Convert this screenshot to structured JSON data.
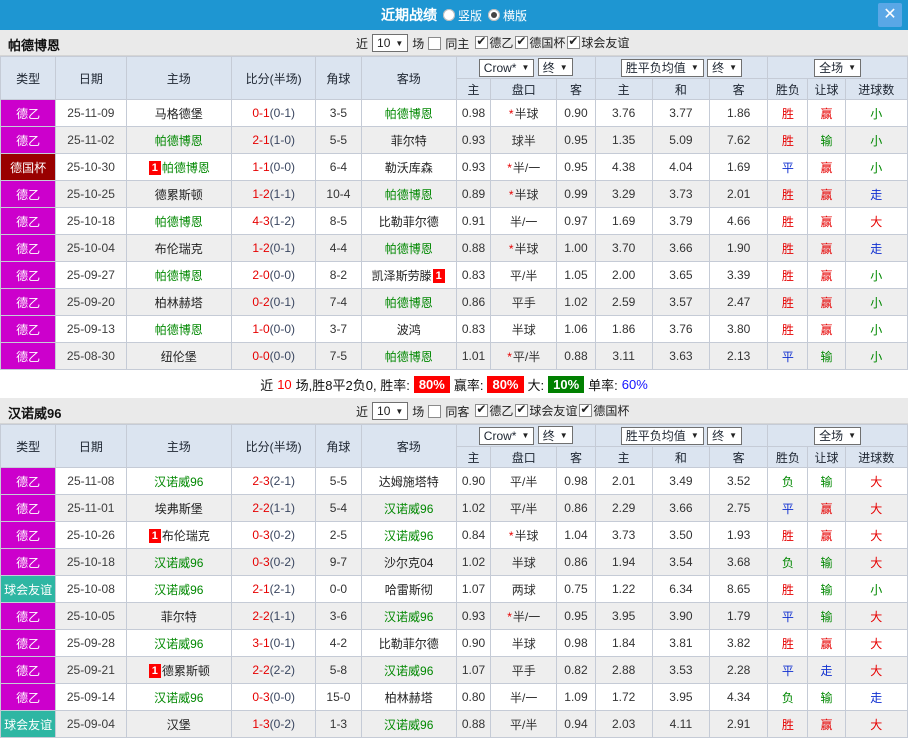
{
  "titlebar": {
    "title": "近期战绩",
    "radio_vertical": "竖版",
    "radio_horizontal": "横版",
    "close": "✕"
  },
  "table_header": {
    "col_type": "类型",
    "col_date": "日期",
    "col_home": "主场",
    "col_score": "比分(半场)",
    "col_corner": "角球",
    "col_away": "客场",
    "odds_dropdown": "Crow*",
    "final_dropdown": "终",
    "avg_dropdown": "胜平负均值",
    "fullmatch_dropdown": "全场",
    "sub_home": "主",
    "sub_handicap": "盘口",
    "sub_away": "客",
    "sub_home2": "主",
    "sub_draw": "和",
    "sub_away2": "客",
    "col_result": "胜负",
    "col_handicap_result": "让球",
    "col_goals": "进球数"
  },
  "sections": [
    {
      "team": "帕德博恩",
      "filter": {
        "near_label": "近",
        "count": "10",
        "matches_label": "场",
        "same_label": "同主",
        "same_checked": false,
        "leagues": [
          {
            "label": "德乙",
            "checked": true
          },
          {
            "label": "德国杯",
            "checked": true
          },
          {
            "label": "球会友谊",
            "checked": true
          }
        ]
      },
      "rows": [
        {
          "type": "德乙",
          "type_class": "t-league",
          "date": "25-11-09",
          "home": "马格德堡",
          "home_green": false,
          "home_badge": false,
          "ft": "0-1",
          "ht": "(0-1)",
          "corner": "3-5",
          "away": "帕德博恩",
          "away_green": true,
          "away_badge": false,
          "odds_home": "0.98",
          "handicap": "半球",
          "handicap_star": true,
          "odds_away": "0.90",
          "avg_home": "3.76",
          "avg_draw": "3.77",
          "avg_away": "1.86",
          "result": [
            "胜",
            "red"
          ],
          "handicap_result": [
            "赢",
            "red"
          ],
          "goals": [
            "小",
            "green"
          ]
        },
        {
          "type": "德乙",
          "type_class": "t-league",
          "date": "25-11-02",
          "home": "帕德博恩",
          "home_green": true,
          "home_badge": false,
          "ft": "2-1",
          "ht": "(1-0)",
          "corner": "5-5",
          "away": "菲尔特",
          "away_green": false,
          "away_badge": false,
          "odds_home": "0.93",
          "handicap": "球半",
          "handicap_star": false,
          "odds_away": "0.95",
          "avg_home": "1.35",
          "avg_draw": "5.09",
          "avg_away": "7.62",
          "result": [
            "胜",
            "red"
          ],
          "handicap_result": [
            "输",
            "green"
          ],
          "goals": [
            "小",
            "green"
          ]
        },
        {
          "type": "德国杯",
          "type_class": "t-cup",
          "date": "25-10-30",
          "home": "帕德博恩",
          "home_green": true,
          "home_badge": true,
          "ft": "1-1",
          "ht": "(0-0)",
          "corner": "6-4",
          "away": "勒沃库森",
          "away_green": false,
          "away_badge": false,
          "odds_home": "0.93",
          "handicap": "半/一",
          "handicap_star": true,
          "odds_away": "0.95",
          "avg_home": "4.38",
          "avg_draw": "4.04",
          "avg_away": "1.69",
          "result": [
            "平",
            "blue"
          ],
          "handicap_result": [
            "赢",
            "red"
          ],
          "goals": [
            "小",
            "green"
          ]
        },
        {
          "type": "德乙",
          "type_class": "t-league",
          "date": "25-10-25",
          "home": "德累斯顿",
          "home_green": false,
          "home_badge": false,
          "ft": "1-2",
          "ht": "(1-1)",
          "corner": "10-4",
          "away": "帕德博恩",
          "away_green": true,
          "away_badge": false,
          "odds_home": "0.89",
          "handicap": "半球",
          "handicap_star": true,
          "odds_away": "0.99",
          "avg_home": "3.29",
          "avg_draw": "3.73",
          "avg_away": "2.01",
          "result": [
            "胜",
            "red"
          ],
          "handicap_result": [
            "赢",
            "red"
          ],
          "goals": [
            "走",
            "blue"
          ]
        },
        {
          "type": "德乙",
          "type_class": "t-league",
          "date": "25-10-18",
          "home": "帕德博恩",
          "home_green": true,
          "home_badge": false,
          "ft": "4-3",
          "ht": "(1-2)",
          "corner": "8-5",
          "away": "比勒菲尔德",
          "away_green": false,
          "away_badge": false,
          "odds_home": "0.91",
          "handicap": "半/一",
          "handicap_star": false,
          "odds_away": "0.97",
          "avg_home": "1.69",
          "avg_draw": "3.79",
          "avg_away": "4.66",
          "result": [
            "胜",
            "red"
          ],
          "handicap_result": [
            "赢",
            "red"
          ],
          "goals": [
            "大",
            "red"
          ]
        },
        {
          "type": "德乙",
          "type_class": "t-league",
          "date": "25-10-04",
          "home": "布伦瑞克",
          "home_green": false,
          "home_badge": false,
          "ft": "1-2",
          "ht": "(0-1)",
          "corner": "4-4",
          "away": "帕德博恩",
          "away_green": true,
          "away_badge": false,
          "odds_home": "0.88",
          "handicap": "半球",
          "handicap_star": true,
          "odds_away": "1.00",
          "avg_home": "3.70",
          "avg_draw": "3.66",
          "avg_away": "1.90",
          "result": [
            "胜",
            "red"
          ],
          "handicap_result": [
            "赢",
            "red"
          ],
          "goals": [
            "走",
            "blue"
          ]
        },
        {
          "type": "德乙",
          "type_class": "t-league",
          "date": "25-09-27",
          "home": "帕德博恩",
          "home_green": true,
          "home_badge": false,
          "ft": "2-0",
          "ht": "(0-0)",
          "corner": "8-2",
          "away": "凯泽斯劳滕",
          "away_green": false,
          "away_badge": true,
          "odds_home": "0.83",
          "handicap": "平/半",
          "handicap_star": false,
          "odds_away": "1.05",
          "avg_home": "2.00",
          "avg_draw": "3.65",
          "avg_away": "3.39",
          "result": [
            "胜",
            "red"
          ],
          "handicap_result": [
            "赢",
            "red"
          ],
          "goals": [
            "小",
            "green"
          ]
        },
        {
          "type": "德乙",
          "type_class": "t-league",
          "date": "25-09-20",
          "home": "柏林赫塔",
          "home_green": false,
          "home_badge": false,
          "ft": "0-2",
          "ht": "(0-1)",
          "corner": "7-4",
          "away": "帕德博恩",
          "away_green": true,
          "away_badge": false,
          "odds_home": "0.86",
          "handicap": "平手",
          "handicap_star": false,
          "odds_away": "1.02",
          "avg_home": "2.59",
          "avg_draw": "3.57",
          "avg_away": "2.47",
          "result": [
            "胜",
            "red"
          ],
          "handicap_result": [
            "赢",
            "red"
          ],
          "goals": [
            "小",
            "green"
          ]
        },
        {
          "type": "德乙",
          "type_class": "t-league",
          "date": "25-09-13",
          "home": "帕德博恩",
          "home_green": true,
          "home_badge": false,
          "ft": "1-0",
          "ht": "(0-0)",
          "corner": "3-7",
          "away": "波鸿",
          "away_green": false,
          "away_badge": false,
          "odds_home": "0.83",
          "handicap": "半球",
          "handicap_star": false,
          "odds_away": "1.06",
          "avg_home": "1.86",
          "avg_draw": "3.76",
          "avg_away": "3.80",
          "result": [
            "胜",
            "red"
          ],
          "handicap_result": [
            "赢",
            "red"
          ],
          "goals": [
            "小",
            "green"
          ]
        },
        {
          "type": "德乙",
          "type_class": "t-league",
          "date": "25-08-30",
          "home": "纽伦堡",
          "home_green": false,
          "home_badge": false,
          "ft": "0-0",
          "ht": "(0-0)",
          "corner": "7-5",
          "away": "帕德博恩",
          "away_green": true,
          "away_badge": false,
          "odds_home": "1.01",
          "handicap": "平/半",
          "handicap_star": true,
          "odds_away": "0.88",
          "avg_home": "3.11",
          "avg_draw": "3.63",
          "avg_away": "2.13",
          "result": [
            "平",
            "blue"
          ],
          "handicap_result": [
            "输",
            "green"
          ],
          "goals": [
            "小",
            "green"
          ]
        }
      ],
      "summary": {
        "text_before": "近",
        "count": "10",
        "text_mid": "场,胜8平2负0, 胜率:",
        "rate1": "80%",
        "label_rate2": "赢率:",
        "rate2": "80%",
        "label_big": "大:",
        "big": "10%",
        "label_single": "单率:",
        "single": "60%"
      }
    },
    {
      "team": "汉诺威96",
      "filter": {
        "near_label": "近",
        "count": "10",
        "matches_label": "场",
        "same_label": "同客",
        "same_checked": false,
        "leagues": [
          {
            "label": "德乙",
            "checked": true
          },
          {
            "label": "球会友谊",
            "checked": true
          },
          {
            "label": "德国杯",
            "checked": true
          }
        ]
      },
      "rows": [
        {
          "type": "德乙",
          "type_class": "t-league",
          "date": "25-11-08",
          "home": "汉诺威96",
          "home_green": true,
          "home_badge": false,
          "ft": "2-3",
          "ht": "(2-1)",
          "corner": "5-5",
          "away": "达姆施塔特",
          "away_green": false,
          "away_badge": false,
          "odds_home": "0.90",
          "handicap": "平/半",
          "handicap_star": false,
          "odds_away": "0.98",
          "avg_home": "2.01",
          "avg_draw": "3.49",
          "avg_away": "3.52",
          "result": [
            "负",
            "green"
          ],
          "handicap_result": [
            "输",
            "green"
          ],
          "goals": [
            "大",
            "red"
          ]
        },
        {
          "type": "德乙",
          "type_class": "t-league",
          "date": "25-11-01",
          "home": "埃弗斯堡",
          "home_green": false,
          "home_badge": false,
          "ft": "2-2",
          "ht": "(1-1)",
          "corner": "5-4",
          "away": "汉诺威96",
          "away_green": true,
          "away_badge": false,
          "odds_home": "1.02",
          "handicap": "平/半",
          "handicap_star": false,
          "odds_away": "0.86",
          "avg_home": "2.29",
          "avg_draw": "3.66",
          "avg_away": "2.75",
          "result": [
            "平",
            "blue"
          ],
          "handicap_result": [
            "赢",
            "red"
          ],
          "goals": [
            "大",
            "red"
          ]
        },
        {
          "type": "德乙",
          "type_class": "t-league",
          "date": "25-10-26",
          "home": "布伦瑞克",
          "home_green": false,
          "home_badge": true,
          "ft": "0-3",
          "ht": "(0-2)",
          "corner": "2-5",
          "away": "汉诺威96",
          "away_green": true,
          "away_badge": false,
          "odds_home": "0.84",
          "handicap": "半球",
          "handicap_star": true,
          "odds_away": "1.04",
          "avg_home": "3.73",
          "avg_draw": "3.50",
          "avg_away": "1.93",
          "result": [
            "胜",
            "red"
          ],
          "handicap_result": [
            "赢",
            "red"
          ],
          "goals": [
            "大",
            "red"
          ]
        },
        {
          "type": "德乙",
          "type_class": "t-league",
          "date": "25-10-18",
          "home": "汉诺威96",
          "home_green": true,
          "home_badge": false,
          "ft": "0-3",
          "ht": "(0-2)",
          "corner": "9-7",
          "away": "沙尔克04",
          "away_green": false,
          "away_badge": false,
          "odds_home": "1.02",
          "handicap": "半球",
          "handicap_star": false,
          "odds_away": "0.86",
          "avg_home": "1.94",
          "avg_draw": "3.54",
          "avg_away": "3.68",
          "result": [
            "负",
            "green"
          ],
          "handicap_result": [
            "输",
            "green"
          ],
          "goals": [
            "大",
            "red"
          ]
        },
        {
          "type": "球会友谊",
          "type_class": "t-friendly",
          "date": "25-10-08",
          "home": "汉诺威96",
          "home_green": true,
          "home_badge": false,
          "ft": "2-1",
          "ht": "(2-1)",
          "corner": "0-0",
          "away": "哈雷斯彻",
          "away_green": false,
          "away_badge": false,
          "odds_home": "1.07",
          "handicap": "两球",
          "handicap_star": false,
          "odds_away": "0.75",
          "avg_home": "1.22",
          "avg_draw": "6.34",
          "avg_away": "8.65",
          "result": [
            "胜",
            "red"
          ],
          "handicap_result": [
            "输",
            "green"
          ],
          "goals": [
            "小",
            "green"
          ]
        },
        {
          "type": "德乙",
          "type_class": "t-league",
          "date": "25-10-05",
          "home": "菲尔特",
          "home_green": false,
          "home_badge": false,
          "ft": "2-2",
          "ht": "(1-1)",
          "corner": "3-6",
          "away": "汉诺威96",
          "away_green": true,
          "away_badge": false,
          "odds_home": "0.93",
          "handicap": "半/一",
          "handicap_star": true,
          "odds_away": "0.95",
          "avg_home": "3.95",
          "avg_draw": "3.90",
          "avg_away": "1.79",
          "result": [
            "平",
            "blue"
          ],
          "handicap_result": [
            "输",
            "green"
          ],
          "goals": [
            "大",
            "red"
          ]
        },
        {
          "type": "德乙",
          "type_class": "t-league",
          "date": "25-09-28",
          "home": "汉诺威96",
          "home_green": true,
          "home_badge": false,
          "ft": "3-1",
          "ht": "(0-1)",
          "corner": "4-2",
          "away": "比勒菲尔德",
          "away_green": false,
          "away_badge": false,
          "odds_home": "0.90",
          "handicap": "半球",
          "handicap_star": false,
          "odds_away": "0.98",
          "avg_home": "1.84",
          "avg_draw": "3.81",
          "avg_away": "3.82",
          "result": [
            "胜",
            "red"
          ],
          "handicap_result": [
            "赢",
            "red"
          ],
          "goals": [
            "大",
            "red"
          ]
        },
        {
          "type": "德乙",
          "type_class": "t-league",
          "date": "25-09-21",
          "home": "德累斯顿",
          "home_green": false,
          "home_badge": true,
          "ft": "2-2",
          "ht": "(2-2)",
          "corner": "5-8",
          "away": "汉诺威96",
          "away_green": true,
          "away_badge": false,
          "odds_home": "1.07",
          "handicap": "平手",
          "handicap_star": false,
          "odds_away": "0.82",
          "avg_home": "2.88",
          "avg_draw": "3.53",
          "avg_away": "2.28",
          "result": [
            "平",
            "blue"
          ],
          "handicap_result": [
            "走",
            "blue"
          ],
          "goals": [
            "大",
            "red"
          ]
        },
        {
          "type": "德乙",
          "type_class": "t-league",
          "date": "25-09-14",
          "home": "汉诺威96",
          "home_green": true,
          "home_badge": false,
          "ft": "0-3",
          "ht": "(0-0)",
          "corner": "15-0",
          "away": "柏林赫塔",
          "away_green": false,
          "away_badge": false,
          "odds_home": "0.80",
          "handicap": "半/一",
          "handicap_star": false,
          "odds_away": "1.09",
          "avg_home": "1.72",
          "avg_draw": "3.95",
          "avg_away": "4.34",
          "result": [
            "负",
            "green"
          ],
          "handicap_result": [
            "输",
            "green"
          ],
          "goals": [
            "走",
            "blue"
          ]
        },
        {
          "type": "球会友谊",
          "type_class": "t-friendly",
          "date": "25-09-04",
          "home": "汉堡",
          "home_green": false,
          "home_badge": false,
          "ft": "1-3",
          "ht": "(0-2)",
          "corner": "1-3",
          "away": "汉诺威96",
          "away_green": true,
          "away_badge": false,
          "odds_home": "0.88",
          "handicap": "平/半",
          "handicap_star": false,
          "odds_away": "0.94",
          "avg_home": "2.03",
          "avg_draw": "4.11",
          "avg_away": "2.91",
          "result": [
            "胜",
            "red"
          ],
          "handicap_result": [
            "赢",
            "red"
          ],
          "goals": [
            "大",
            "red"
          ]
        }
      ],
      "summary": null
    }
  ],
  "colors": {
    "titlebar": "#1e96d2",
    "league_type": "#cc00cc",
    "cup_type": "#990000",
    "friendly_type": "#2eb6a3",
    "win": "#e60000",
    "draw": "#0f2fd0",
    "loss": "#008800",
    "team_highlight": "#008800"
  }
}
